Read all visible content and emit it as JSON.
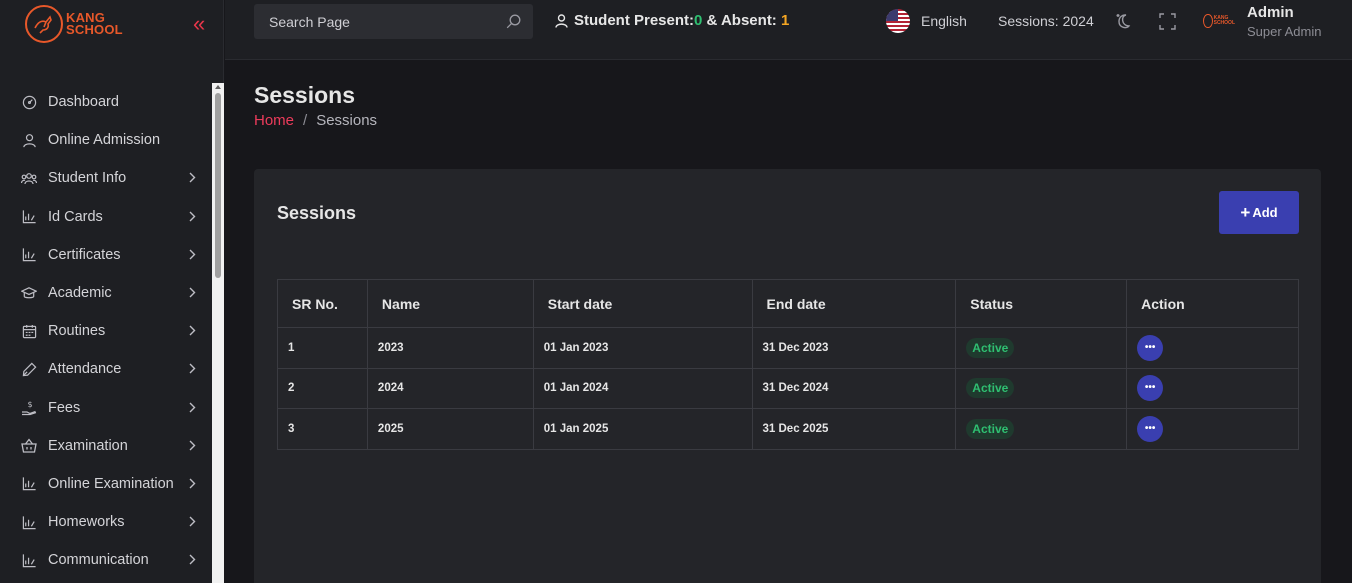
{
  "brand": {
    "line1": "KANG",
    "line2": "SCHOOL",
    "accent": "#e8582a"
  },
  "sidebar": {
    "collapse_symbol": "«",
    "items": [
      {
        "label": "Dashboard",
        "icon": "gauge-icon",
        "has_children": false
      },
      {
        "label": "Online Admission",
        "icon": "user-icon",
        "has_children": false
      },
      {
        "label": "Student Info",
        "icon": "users-icon",
        "has_children": true
      },
      {
        "label": "Id Cards",
        "icon": "chart-icon",
        "has_children": true
      },
      {
        "label": "Certificates",
        "icon": "chart-icon",
        "has_children": true
      },
      {
        "label": "Academic",
        "icon": "graduation-cap-icon",
        "has_children": true
      },
      {
        "label": "Routines",
        "icon": "calendar-icon",
        "has_children": true
      },
      {
        "label": "Attendance",
        "icon": "pen-icon",
        "has_children": true
      },
      {
        "label": "Fees",
        "icon": "dollar-hand-icon",
        "has_children": true
      },
      {
        "label": "Examination",
        "icon": "basket-icon",
        "has_children": true
      },
      {
        "label": "Online Examination",
        "icon": "chart-icon",
        "has_children": true
      },
      {
        "label": "Homeworks",
        "icon": "chart-icon",
        "has_children": true
      },
      {
        "label": "Communication",
        "icon": "chart-icon",
        "has_children": true
      }
    ]
  },
  "header": {
    "search_placeholder": "Search Page",
    "presence_prefix": "Student Present: ",
    "present_count": "0",
    "presence_mid": " & Absent: ",
    "absent_count": "1",
    "language": "English",
    "sessions": "Sessions: 2024",
    "user_name": "Admin",
    "user_role": "Super Admin"
  },
  "page": {
    "title": "Sessions",
    "breadcrumb_home": "Home",
    "breadcrumb_sep": "/",
    "breadcrumb_current": "Sessions"
  },
  "card": {
    "title": "Sessions",
    "add_plus": "+",
    "add_label": "Add"
  },
  "table": {
    "headers": [
      "SR No.",
      "Name",
      "Start date",
      "End date",
      "Status",
      "Action"
    ],
    "rows": [
      {
        "sr": "1",
        "name": "2023",
        "start": "01 Jan 2023",
        "end": "31 Dec 2023",
        "status": "Active",
        "action": "•••"
      },
      {
        "sr": "2",
        "name": "2024",
        "start": "01 Jan 2024",
        "end": "31 Dec 2024",
        "status": "Active",
        "action": "•••"
      },
      {
        "sr": "3",
        "name": "2025",
        "start": "01 Jan 2025",
        "end": "31 Dec 2025",
        "status": "Active",
        "action": "•••"
      }
    ]
  },
  "colors": {
    "primary": "#3a3fb0",
    "danger": "#ec3b5b",
    "success": "#2fbf71",
    "warning": "#f5a623"
  }
}
